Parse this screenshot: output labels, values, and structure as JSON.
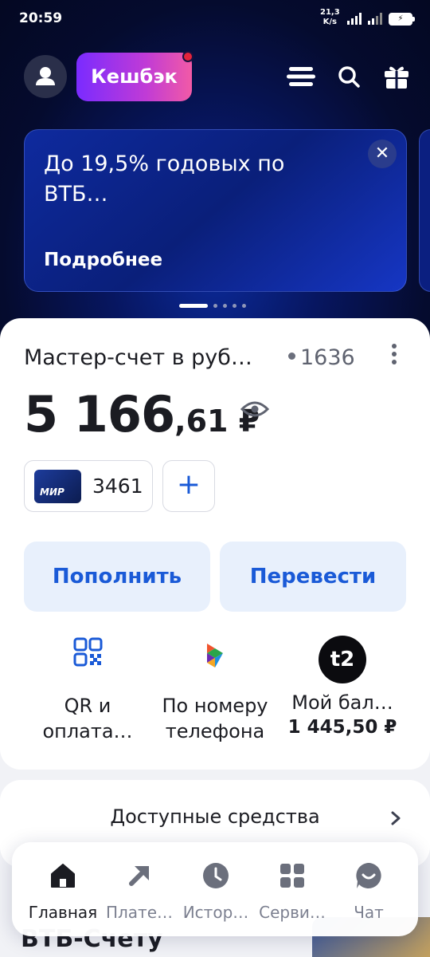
{
  "status_bar": {
    "time": "20:59",
    "speed_value": "21,3",
    "speed_unit": "K/s",
    "battery": "⚡"
  },
  "header": {
    "cashback_label": "Кешбэк",
    "icons": [
      "profile-icon",
      "menu-icon",
      "search-icon",
      "gift-icon"
    ]
  },
  "promo": {
    "title": "До 19,5% годовых по ВТБ…",
    "more_label": "Подробнее",
    "close_label": "✕"
  },
  "account": {
    "name": "Мастер-счет в руб…",
    "number": "1636",
    "balance_int": "5 166",
    "balance_frac": ",61 ₽",
    "card_brand": "МИР",
    "card_last4": "3461",
    "add_card_label": "+"
  },
  "actions": {
    "topup_label": "Пополнить",
    "transfer_label": "Перевести"
  },
  "quick_actions": [
    {
      "line1": "QR и",
      "line2": "оплата…"
    },
    {
      "line1": "По номеру",
      "line2": "телефона"
    },
    {
      "line1": "Мой бал…",
      "line2": "1 445,50 ₽"
    }
  ],
  "operator_logo": "t2",
  "available": {
    "label": "Доступные средства"
  },
  "section_peek": "ВТБ-Счету",
  "nav": [
    {
      "label": "Главная"
    },
    {
      "label": "Плате…"
    },
    {
      "label": "Истор…"
    },
    {
      "label": "Серви…"
    },
    {
      "label": "Чат"
    }
  ],
  "colors": {
    "accent": "#1a5ad7",
    "header_bg": "#050b2e",
    "cashback_from": "#7a2bff",
    "cashback_to": "#f25aa6"
  }
}
